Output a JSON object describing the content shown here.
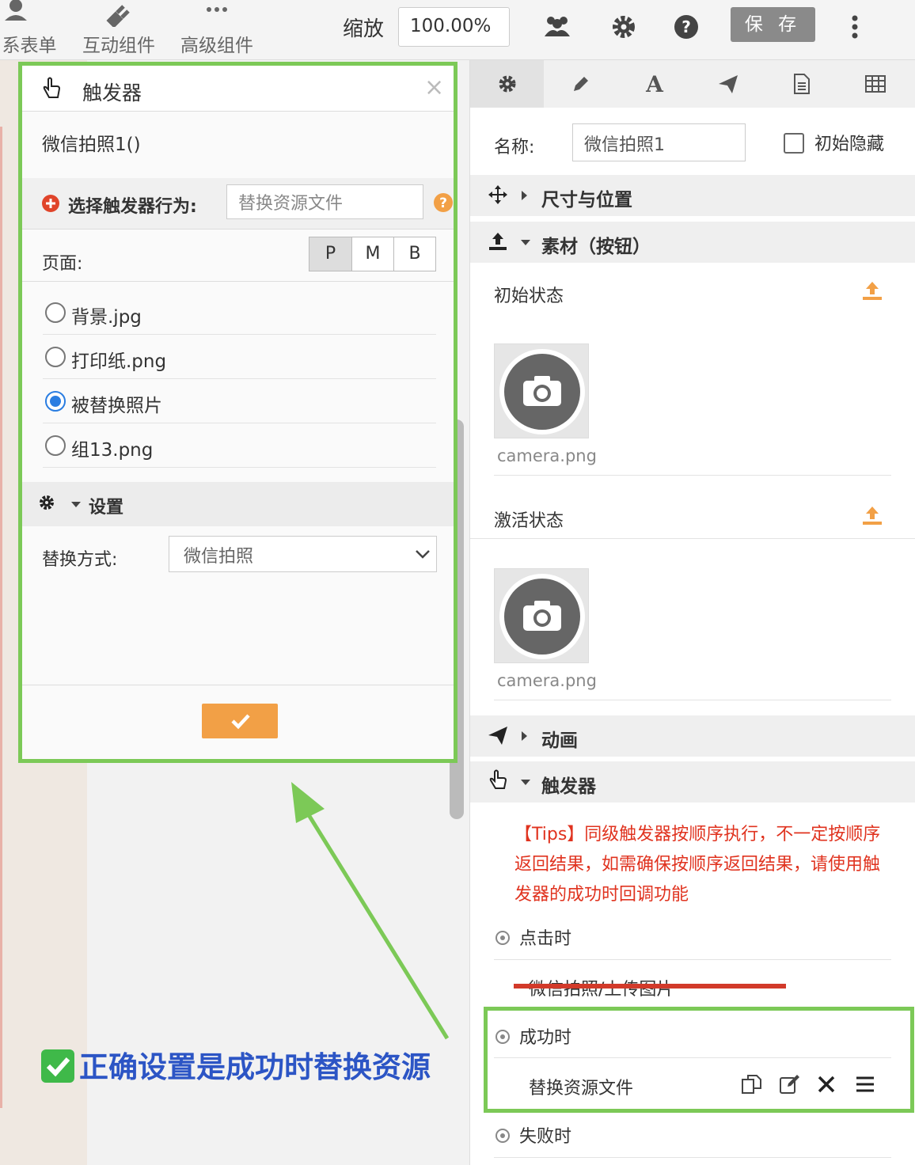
{
  "toolbar": {
    "items": [
      {
        "label": "系表单",
        "icon": "user-icon"
      },
      {
        "label": "互动组件",
        "icon": "plug-icon"
      },
      {
        "label": "高级组件",
        "icon": "more-dots-icon"
      }
    ],
    "zoom_label": "缩放",
    "zoom_value": "100.00%",
    "save_label": "保 存"
  },
  "modal": {
    "title": "触发器",
    "close": "×",
    "trigger_name": "微信拍照1()",
    "action_label": "选择触发器行为:",
    "action_value": "替换资源文件",
    "page_label": "页面:",
    "page_options": [
      "P",
      "M",
      "B"
    ],
    "resources": [
      {
        "name": "背景.jpg",
        "selected": false
      },
      {
        "name": "打印纸.png",
        "selected": false
      },
      {
        "name": "被替换照片",
        "selected": true
      },
      {
        "name": "组13.png",
        "selected": false
      }
    ],
    "settings_label": "设置",
    "replace_label": "替换方式:",
    "replace_value": "微信拍照"
  },
  "right_panel": {
    "name_label": "名称:",
    "name_value": "微信拍照1",
    "hidden_label": "初始隐藏",
    "section_size": "尺寸与位置",
    "section_material": "素材（按钮）",
    "initial_state": "初始状态",
    "initial_file": "camera.png",
    "active_state": "激活状态",
    "active_file": "camera.png",
    "section_animation": "动画",
    "section_trigger": "触发器",
    "tips": "【Tips】同级触发器按顺序执行，不一定按顺序返回结果，如需确保按顺序返回结果，请使用触发器的成功时回调功能",
    "on_click": "点击时",
    "on_click_action": "微信拍照/上传图片",
    "on_success": "成功时",
    "on_success_action": "替换资源文件",
    "on_fail": "失败时"
  },
  "annotation": "正确设置是成功时替换资源",
  "colors": {
    "accent_green": "#7cc957",
    "ok_orange": "#f2a046",
    "tips_red": "#e0331f",
    "annot_blue": "#2c55c5"
  }
}
